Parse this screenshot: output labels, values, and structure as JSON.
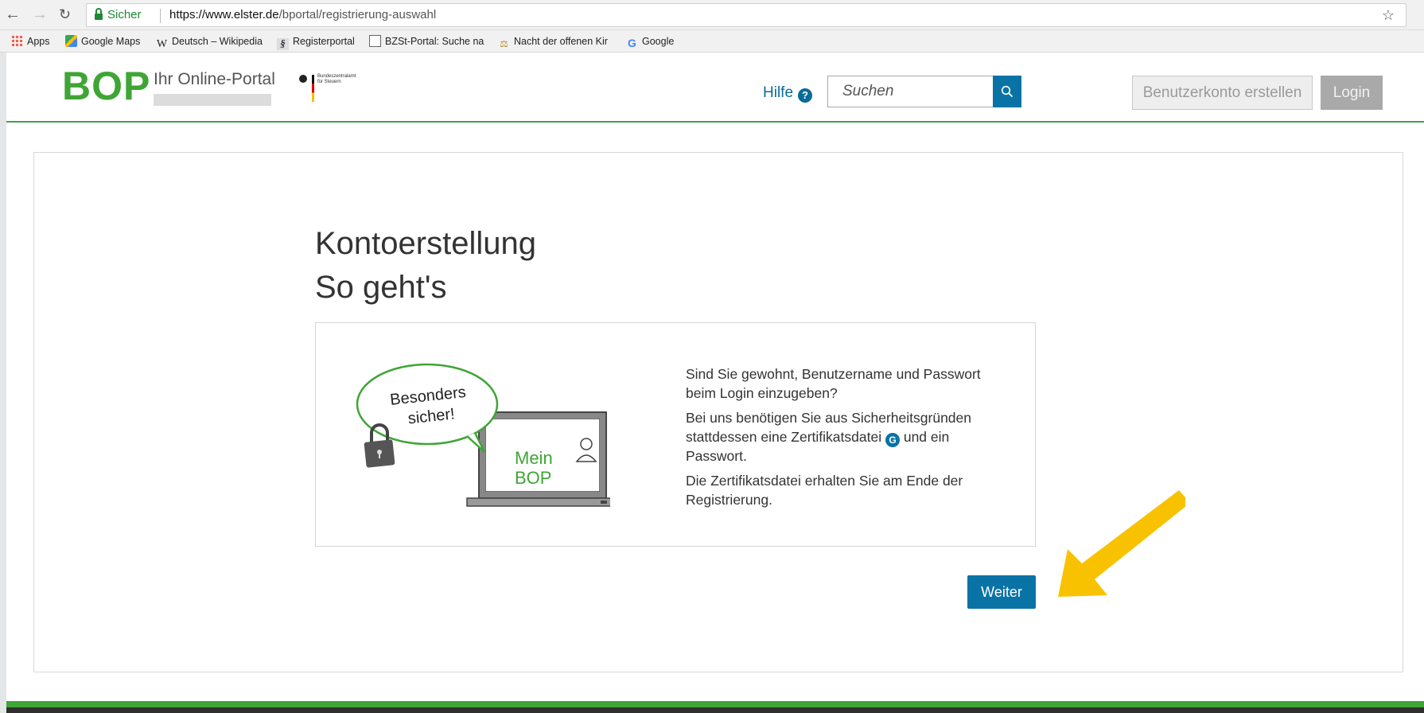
{
  "browser": {
    "secure_label": "Sicher",
    "url_domain": "https://www.elster.de",
    "url_path": "/bportal/registrierung-auswahl",
    "bookmarks": [
      {
        "label": "Apps",
        "icon": "apps-grid-icon"
      },
      {
        "label": "Google Maps",
        "icon": "google-maps-icon"
      },
      {
        "label": "Deutsch – Wikipedia",
        "icon": "wikipedia-icon"
      },
      {
        "label": "Registerportal",
        "icon": "paragraph-icon"
      },
      {
        "label": "BZSt-Portal: Suche na",
        "icon": "document-icon"
      },
      {
        "label": "Nacht der offenen Kir",
        "icon": "scale-icon"
      },
      {
        "label": "Google",
        "icon": "google-icon"
      }
    ]
  },
  "header": {
    "logo": "BOP",
    "logo_subtitle": "Ihr Online-Portal",
    "help_label": "Hilfe",
    "help_icon": "?",
    "search_placeholder": "Suchen",
    "create_account_label": "Benutzerkonto erstellen",
    "login_label": "Login"
  },
  "main": {
    "title_line1": "Kontoerstellung",
    "title_line2": "So geht's",
    "illustration": {
      "bubble_line1": "Besonders",
      "bubble_line2": "sicher!",
      "screen_line1": "Mein",
      "screen_line2": "BOP"
    },
    "paragraph1": "Sind Sie gewohnt, Benutzername und Passwort beim Login einzugeben?",
    "paragraph2_before": "Bei uns benötigen Sie aus Sicherheitsgründen stattdessen eine Zertifikatsdatei",
    "glossary_badge": "G",
    "paragraph2_after": " und ein Passwort.",
    "paragraph3": "Die Zertifikatsdatei erhalten Sie am Ende der Registrierung.",
    "next_button": "Weiter"
  },
  "colors": {
    "brand_green": "#3fa535",
    "primary_blue": "#0a73a6",
    "arrow_yellow": "#f9c200"
  }
}
